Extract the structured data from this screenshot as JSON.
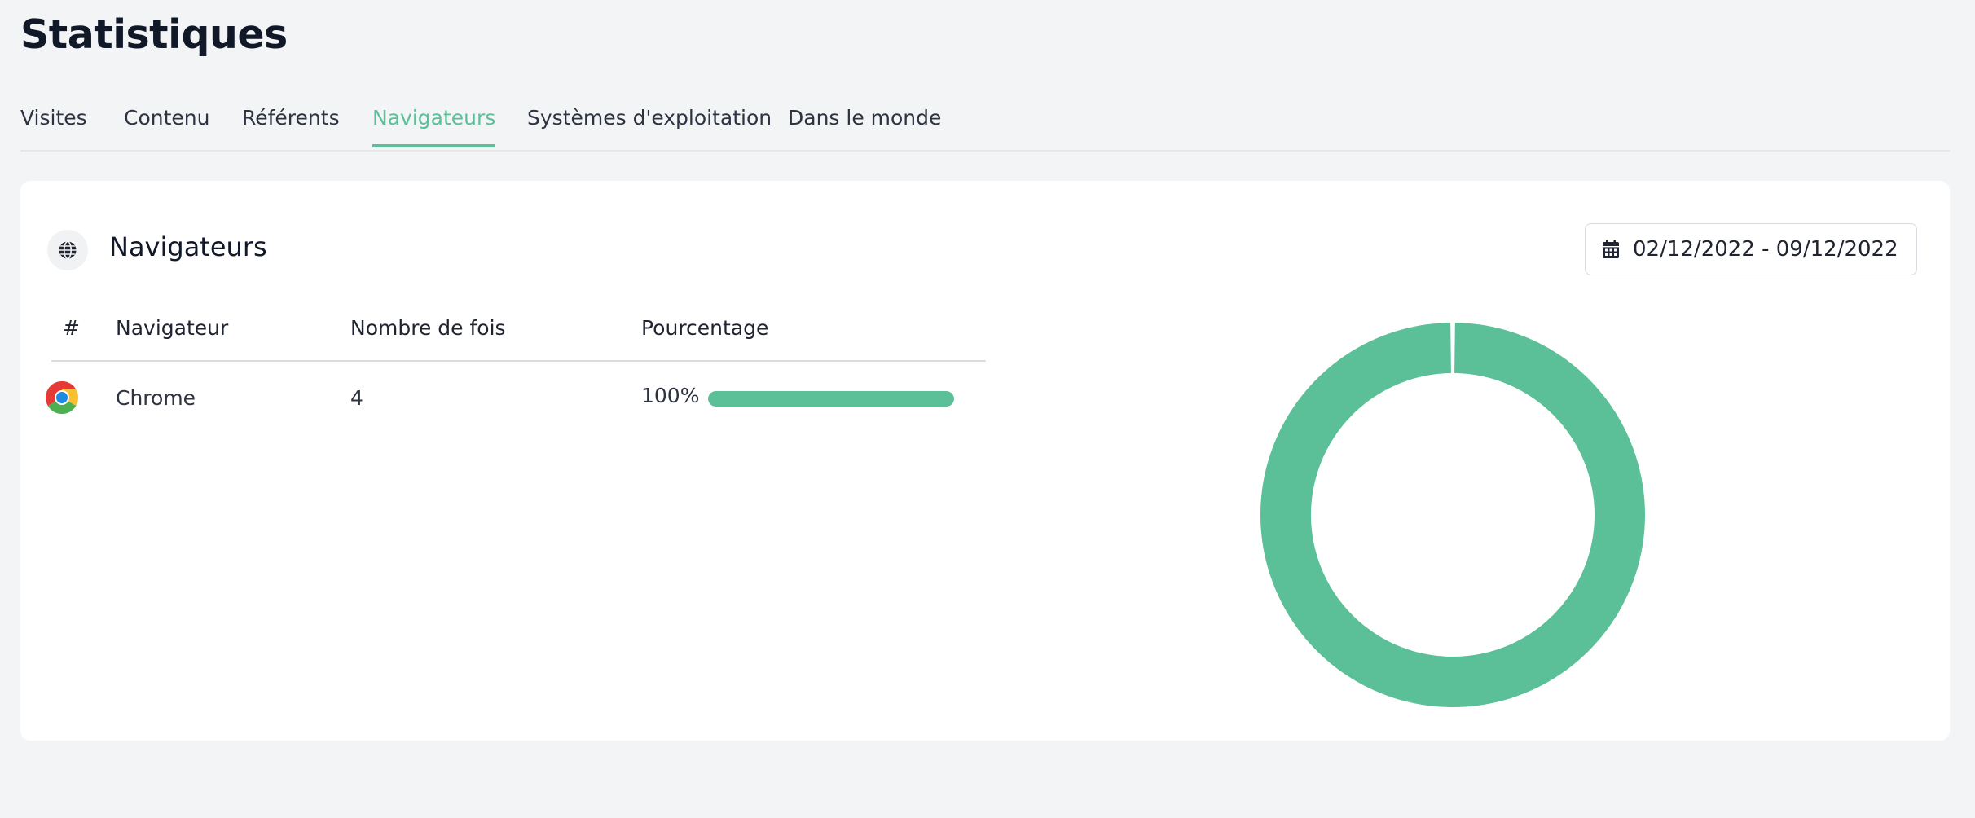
{
  "page": {
    "title": "Statistiques"
  },
  "tabs": [
    {
      "label": "Visites",
      "active": false
    },
    {
      "label": "Contenu",
      "active": false
    },
    {
      "label": "Référents",
      "active": false
    },
    {
      "label": "Navigateurs",
      "active": true
    },
    {
      "label": "Systèmes d'exploitation",
      "active": false
    },
    {
      "label": "Dans le monde",
      "active": false
    }
  ],
  "card": {
    "title": "Navigateurs",
    "icon": "globe-icon",
    "date_range": "02/12/2022 - 09/12/2022",
    "date_icon": "calendar-icon"
  },
  "table": {
    "headers": [
      "#",
      "Navigateur",
      "Nombre de fois",
      "Pourcentage"
    ],
    "rows": [
      {
        "icon": "chrome-icon",
        "browser": "Chrome",
        "count": "4",
        "percentage": "100%",
        "fraction": 1.0
      }
    ]
  },
  "chart_data": {
    "type": "pie",
    "style": "donut",
    "categories": [
      "Chrome"
    ],
    "values": [
      4
    ],
    "colors": [
      "#5bbf98"
    ]
  },
  "colors": {
    "accent": "#5bbf98",
    "background": "#f3f4f6",
    "card": "#ffffff"
  }
}
